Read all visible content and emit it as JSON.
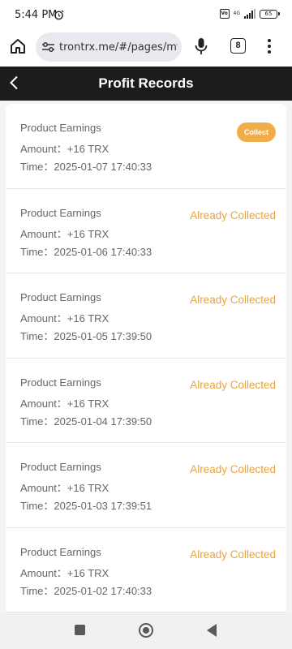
{
  "status_bar": {
    "time": "5:44 PM",
    "icons": [
      "alarm-icon",
      "volte-icon",
      "signal-icon"
    ],
    "network_label": "4G",
    "battery": "65"
  },
  "browser": {
    "url": "trontrx.me/#/pages/my/s",
    "tab_count": "8",
    "icons": [
      "home-icon",
      "tune-icon",
      "mic-icon",
      "more-vert-icon"
    ]
  },
  "header": {
    "title": "Profit Records",
    "back_icon": "chevron-left-icon"
  },
  "records": [
    {
      "title": "Product Earnings",
      "amount": "Amount：+16 TRX",
      "time": "Time：2025-01-07 17:40:33",
      "status": "Collect",
      "collectable": true
    },
    {
      "title": "Product Earnings",
      "amount": "Amount：+16 TRX",
      "time": "Time：2025-01-06 17:40:33",
      "status": "Already Collected",
      "collectable": false
    },
    {
      "title": "Product Earnings",
      "amount": "Amount：+16 TRX",
      "time": "Time：2025-01-05 17:39:50",
      "status": "Already Collected",
      "collectable": false
    },
    {
      "title": "Product Earnings",
      "amount": "Amount：+16 TRX",
      "time": "Time：2025-01-04 17:39:50",
      "status": "Already Collected",
      "collectable": false
    },
    {
      "title": "Product Earnings",
      "amount": "Amount：+16 TRX",
      "time": "Time：2025-01-03 17:39:51",
      "status": "Already Collected",
      "collectable": false
    },
    {
      "title": "Product Earnings",
      "amount": "Amount：+16 TRX",
      "time": "Time：2025-01-02 17:40:33",
      "status": "Already Collected",
      "collectable": false
    }
  ],
  "colors": {
    "accent": "#f2ad4b",
    "collected_text": "#e9a43c",
    "header_bg": "#1c1c1c"
  },
  "nav": {
    "icons": [
      "recent-apps-icon",
      "home-circle-icon",
      "back-triangle-icon"
    ]
  }
}
